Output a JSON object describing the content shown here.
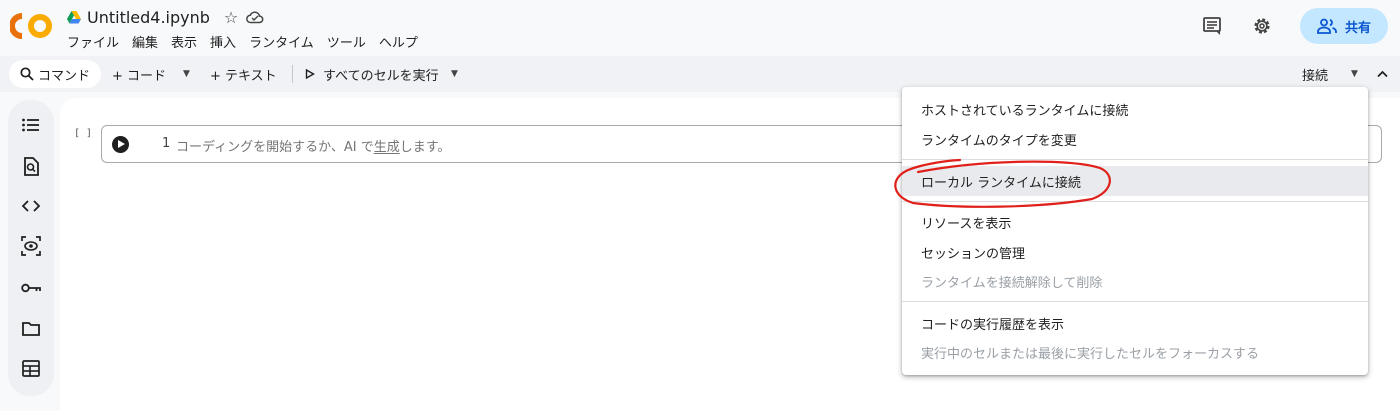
{
  "app": {
    "notebook_title": "Untitled4.ipynb",
    "logo_text": "CO"
  },
  "menubar": {
    "items": [
      "ファイル",
      "編集",
      "表示",
      "挿入",
      "ランタイム",
      "ツール",
      "ヘルプ"
    ]
  },
  "header": {
    "share_label": "共有"
  },
  "toolbar": {
    "command_label": "コマンド",
    "code_label": "+ コード",
    "text_label": "+ テキスト",
    "run_all_label": "すべてのセルを実行",
    "connect_label": "接続"
  },
  "cell": {
    "exec_count": "[ ]",
    "line_number": "1",
    "placeholder_before": "コーディングを開始するか、AI で",
    "placeholder_link": "生成",
    "placeholder_after": "します。"
  },
  "connect_menu": {
    "items": [
      {
        "label": "ホストされているランタイムに接続",
        "disabled": false
      },
      {
        "label": "ランタイムのタイプを変更",
        "disabled": false
      },
      {
        "label": "ローカル ランタイムに接続",
        "disabled": false,
        "highlighted": true
      },
      {
        "label": "リソースを表示",
        "disabled": false
      },
      {
        "label": "セッションの管理",
        "disabled": false
      },
      {
        "label": "ランタイムを接続解除して削除",
        "disabled": true
      },
      {
        "label": "コードの実行履歴を表示",
        "disabled": false
      },
      {
        "label": "実行中のセルまたは最後に実行したセルをフォーカスする",
        "disabled": true
      }
    ]
  },
  "colors": {
    "logo_orange": "#f9ab00",
    "logo_dark_orange": "#e8710a",
    "share_bg": "#c2e7ff",
    "share_text": "#0b57d0",
    "annotation_red": "#e0201b"
  },
  "icons": [
    "drive-icon",
    "star-icon",
    "cloud-icon",
    "comment-icon",
    "gear-icon",
    "people-icon",
    "search-icon",
    "play-icon",
    "toc-icon",
    "find-icon",
    "code-icon",
    "variables-icon",
    "key-icon",
    "folder-icon",
    "table-icon"
  ]
}
